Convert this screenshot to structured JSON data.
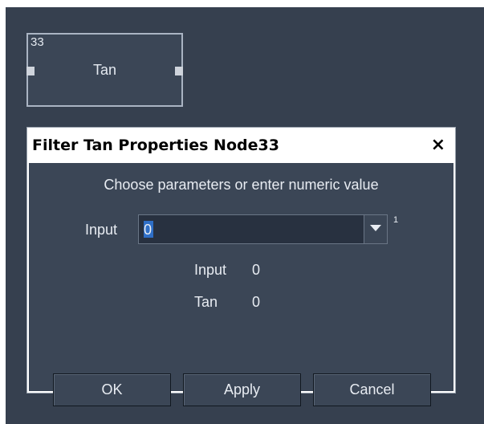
{
  "node": {
    "id": "33",
    "label": "Tan"
  },
  "dialog": {
    "title": "Filter Tan Properties Node33",
    "close_label": "×",
    "subtitle": "Choose parameters or enter numeric value",
    "input": {
      "label": "Input",
      "value": "0",
      "superscript": "1"
    },
    "values": [
      {
        "name": "Input",
        "value": "0"
      },
      {
        "name": "Tan",
        "value": "0"
      }
    ],
    "buttons": {
      "ok": "OK",
      "apply": "Apply",
      "cancel": "Cancel"
    }
  },
  "colors": {
    "canvas": "#36404f",
    "panel": "#3b4656",
    "field": "#283140",
    "text": "#e8ecf2",
    "selection": "#2f6fc7"
  }
}
